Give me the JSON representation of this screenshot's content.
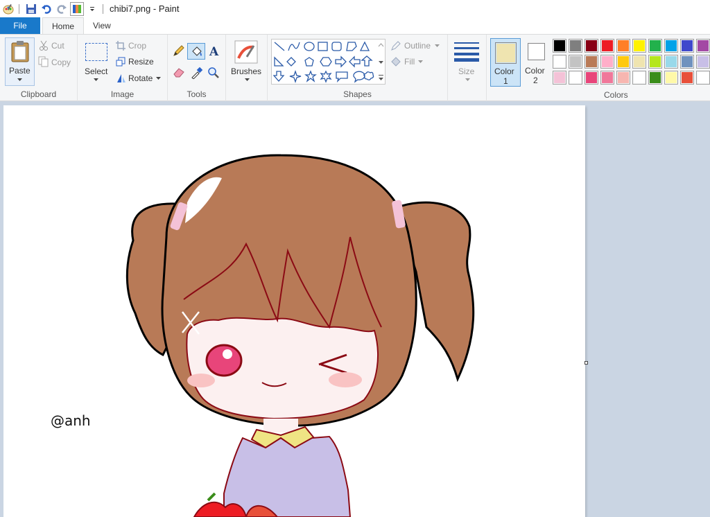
{
  "window": {
    "title": "chibi7.png - Paint"
  },
  "tabs": [
    {
      "label": "File"
    },
    {
      "label": "Home"
    },
    {
      "label": "View"
    }
  ],
  "ribbon": {
    "clipboard": {
      "group_label": "Clipboard",
      "paste": "Paste",
      "cut": "Cut",
      "copy": "Copy"
    },
    "image": {
      "group_label": "Image",
      "select": "Select",
      "crop": "Crop",
      "resize": "Resize",
      "rotate": "Rotate"
    },
    "tools": {
      "group_label": "Tools"
    },
    "brushes": {
      "label": "Brushes"
    },
    "shapes": {
      "group_label": "Shapes",
      "outline": "Outline",
      "fill": "Fill"
    },
    "size": {
      "label": "Size"
    },
    "color1": {
      "line1": "Color",
      "line2": "1",
      "value": "#efe4b0"
    },
    "color2": {
      "line1": "Color",
      "line2": "2",
      "value": "#ffffff"
    },
    "colors": {
      "group_label": "Colors",
      "row1": [
        "#000000",
        "#7f7f7f",
        "#880015",
        "#ed1c24",
        "#ff7f27",
        "#fff200",
        "#22b14c",
        "#00a2e8",
        "#3f48cc",
        "#a349a4"
      ],
      "row2": [
        "#ffffff",
        "#c3c3c3",
        "#b97a57",
        "#ffaec9",
        "#ffc90e",
        "#efe4b0",
        "#b5e61d",
        "#99d9ea",
        "#7092be",
        "#c8bfe7"
      ],
      "row3": [
        "#f4c2d7",
        "#ffffff",
        "#e8457a",
        "#f0789a",
        "#f7b6b0",
        "#ffffff",
        "#3a8d1a",
        "#fff9a8",
        "#e8503a",
        "#ffffff"
      ]
    }
  },
  "canvas": {
    "signature": "@anh",
    "accent_colors": {
      "hair": "#b87a57",
      "outline": "#8b0a14",
      "shirt": "#c8bfe7",
      "collar": "#efe484",
      "skin": "#fcf0f0",
      "blush": "#f9c3c3",
      "eye": "#e8457a"
    }
  }
}
